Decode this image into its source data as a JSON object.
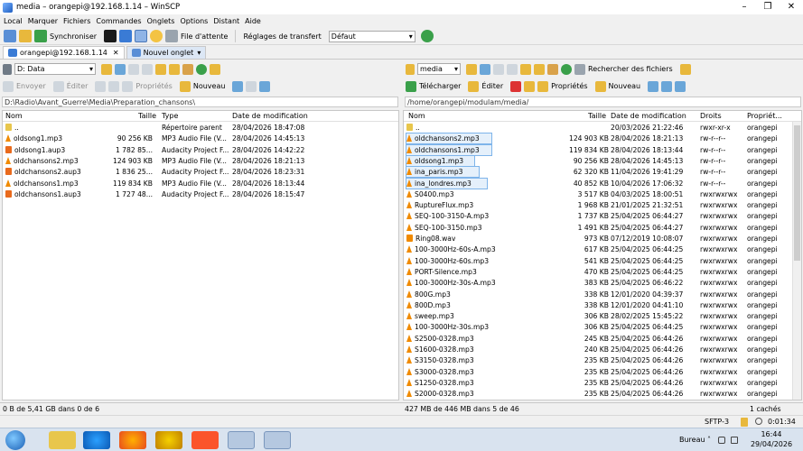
{
  "window": {
    "title": "media – orangepi@192.168.1.14 – WinSCP",
    "min": "–",
    "max": "❐",
    "close": "✕"
  },
  "menu": [
    "Local",
    "Marquer",
    "Fichiers",
    "Commandes",
    "Onglets",
    "Options",
    "Distant",
    "Aide"
  ],
  "toolbar": {
    "sync": "Synchroniser",
    "queue": "File d'attente",
    "transfer_settings": "Réglages de transfert",
    "transfer_value": "Défaut"
  },
  "tabs": {
    "session": "orangepi@192.168.1.14",
    "new": "Nouvel onglet"
  },
  "left": {
    "drive": "D: Data",
    "send": "Envoyer",
    "edit": "Éditer",
    "props": "Propriétés",
    "new": "Nouveau",
    "path": "D:\\Radio\\Avant_Guerre\\Media\\Preparation_chansons\\",
    "cols": [
      "Nom",
      "Taille",
      "Type",
      "Date de modification"
    ],
    "rows": [
      {
        "name": "..",
        "size": "",
        "type": "Répertoire parent",
        "date": "28/04/2026 18:47:08",
        "icon": "up"
      },
      {
        "name": "oldsong1.mp3",
        "size": "90 256 KB",
        "type": "MP3 Audio File (V...",
        "date": "28/04/2026 14:45:13",
        "icon": "mp3"
      },
      {
        "name": "oldsong1.aup3",
        "size": "1 782 85...",
        "type": "Audacity Project F...",
        "date": "28/04/2026 14:42:22",
        "icon": "aup"
      },
      {
        "name": "oldchansons2.mp3",
        "size": "124 903 KB",
        "type": "MP3 Audio File (V...",
        "date": "28/04/2026 18:21:13",
        "icon": "mp3"
      },
      {
        "name": "oldchansons2.aup3",
        "size": "1 836 25...",
        "type": "Audacity Project F...",
        "date": "28/04/2026 18:23:31",
        "icon": "aup"
      },
      {
        "name": "oldchansons1.mp3",
        "size": "119 834 KB",
        "type": "MP3 Audio File (V...",
        "date": "28/04/2026 18:13:44",
        "icon": "mp3"
      },
      {
        "name": "oldchansons1.aup3",
        "size": "1 727 48...",
        "type": "Audacity Project F...",
        "date": "28/04/2026 18:15:47",
        "icon": "aup"
      }
    ],
    "status": "0 B de 5,41 GB dans 0 de 6"
  },
  "right": {
    "folder": "media",
    "search": "Rechercher des fichiers",
    "download": "Télécharger",
    "edit": "Éditer",
    "props": "Propriétés",
    "new": "Nouveau",
    "path": "/home/orangepi/modulam/media/",
    "cols": [
      "Nom",
      "Taille",
      "Date de modification",
      "Droits",
      "Propriét..."
    ],
    "rows": [
      {
        "name": "..",
        "size": "",
        "date": "20/03/2026 21:22:46",
        "rights": "rwxr-xr-x",
        "owner": "orangepi",
        "icon": "up",
        "sel": false
      },
      {
        "name": "oldchansons2.mp3",
        "size": "124 903 KB",
        "date": "28/04/2026 18:21:13",
        "rights": "rw-r--r--",
        "owner": "orangepi",
        "icon": "mp3",
        "sel": true
      },
      {
        "name": "oldchansons1.mp3",
        "size": "119 834 KB",
        "date": "28/04/2026 18:13:44",
        "rights": "rw-r--r--",
        "owner": "orangepi",
        "icon": "mp3",
        "sel": true
      },
      {
        "name": "oldsong1.mp3",
        "size": "90 256 KB",
        "date": "28/04/2026 14:45:13",
        "rights": "rw-r--r--",
        "owner": "orangepi",
        "icon": "mp3",
        "sel": true
      },
      {
        "name": "ina_paris.mp3",
        "size": "62 320 KB",
        "date": "11/04/2026 19:41:29",
        "rights": "rw-r--r--",
        "owner": "orangepi",
        "icon": "mp3",
        "sel": true
      },
      {
        "name": "ina_londres.mp3",
        "size": "40 852 KB",
        "date": "10/04/2026 17:06:32",
        "rights": "rw-r--r--",
        "owner": "orangepi",
        "icon": "mp3",
        "sel": true
      },
      {
        "name": "S0400.mp3",
        "size": "3 517 KB",
        "date": "04/03/2025 18:00:51",
        "rights": "rwxrwxrwx",
        "owner": "orangepi",
        "icon": "mp3",
        "sel": false
      },
      {
        "name": "RuptureFlux.mp3",
        "size": "1 968 KB",
        "date": "21/01/2025 21:32:51",
        "rights": "rwxrwxrwx",
        "owner": "orangepi",
        "icon": "mp3",
        "sel": false
      },
      {
        "name": "SEQ-100-3150-A.mp3",
        "size": "1 737 KB",
        "date": "25/04/2025 06:44:27",
        "rights": "rwxrwxrwx",
        "owner": "orangepi",
        "icon": "mp3",
        "sel": false
      },
      {
        "name": "SEQ-100-3150.mp3",
        "size": "1 491 KB",
        "date": "25/04/2025 06:44:27",
        "rights": "rwxrwxrwx",
        "owner": "orangepi",
        "icon": "mp3",
        "sel": false
      },
      {
        "name": "Ring08.wav",
        "size": "973 KB",
        "date": "07/12/2019 10:08:07",
        "rights": "rwxrwxrwx",
        "owner": "orangepi",
        "icon": "wav",
        "sel": false
      },
      {
        "name": "100-3000Hz-60s-A.mp3",
        "size": "617 KB",
        "date": "25/04/2025 06:44:25",
        "rights": "rwxrwxrwx",
        "owner": "orangepi",
        "icon": "mp3",
        "sel": false
      },
      {
        "name": "100-3000Hz-60s.mp3",
        "size": "541 KB",
        "date": "25/04/2025 06:44:25",
        "rights": "rwxrwxrwx",
        "owner": "orangepi",
        "icon": "mp3",
        "sel": false
      },
      {
        "name": "PORT-Silence.mp3",
        "size": "470 KB",
        "date": "25/04/2025 06:44:25",
        "rights": "rwxrwxrwx",
        "owner": "orangepi",
        "icon": "mp3",
        "sel": false
      },
      {
        "name": "100-3000Hz-30s-A.mp3",
        "size": "383 KB",
        "date": "25/04/2025 06:46:22",
        "rights": "rwxrwxrwx",
        "owner": "orangepi",
        "icon": "mp3",
        "sel": false
      },
      {
        "name": "800G.mp3",
        "size": "338 KB",
        "date": "12/01/2020 04:39:37",
        "rights": "rwxrwxrwx",
        "owner": "orangepi",
        "icon": "mp3",
        "sel": false
      },
      {
        "name": "800D.mp3",
        "size": "338 KB",
        "date": "12/01/2020 04:41:10",
        "rights": "rwxrwxrwx",
        "owner": "orangepi",
        "icon": "mp3",
        "sel": false
      },
      {
        "name": "sweep.mp3",
        "size": "306 KB",
        "date": "28/02/2025 15:45:22",
        "rights": "rwxrwxrwx",
        "owner": "orangepi",
        "icon": "mp3",
        "sel": false
      },
      {
        "name": "100-3000Hz-30s.mp3",
        "size": "306 KB",
        "date": "25/04/2025 06:44:25",
        "rights": "rwxrwxrwx",
        "owner": "orangepi",
        "icon": "mp3",
        "sel": false
      },
      {
        "name": "S2500-0328.mp3",
        "size": "245 KB",
        "date": "25/04/2025 06:44:26",
        "rights": "rwxrwxrwx",
        "owner": "orangepi",
        "icon": "mp3",
        "sel": false
      },
      {
        "name": "S1600-0328.mp3",
        "size": "240 KB",
        "date": "25/04/2025 06:44:26",
        "rights": "rwxrwxrwx",
        "owner": "orangepi",
        "icon": "mp3",
        "sel": false
      },
      {
        "name": "S3150-0328.mp3",
        "size": "235 KB",
        "date": "25/04/2025 06:44:26",
        "rights": "rwxrwxrwx",
        "owner": "orangepi",
        "icon": "mp3",
        "sel": false
      },
      {
        "name": "S3000-0328.mp3",
        "size": "235 KB",
        "date": "25/04/2025 06:44:26",
        "rights": "rwxrwxrwx",
        "owner": "orangepi",
        "icon": "mp3",
        "sel": false
      },
      {
        "name": "S1250-0328.mp3",
        "size": "235 KB",
        "date": "25/04/2025 06:44:26",
        "rights": "rwxrwxrwx",
        "owner": "orangepi",
        "icon": "mp3",
        "sel": false
      },
      {
        "name": "S2000-0328.mp3",
        "size": "235 KB",
        "date": "25/04/2025 06:44:26",
        "rights": "rwxrwxrwx",
        "owner": "orangepi",
        "icon": "mp3",
        "sel": false
      }
    ],
    "status": "427 MB de 446 MB dans 5 de 46",
    "hidden": "1 cachés"
  },
  "statusbar": {
    "protocol": "SFTP-3",
    "time": "0:01:34"
  },
  "taskbar": {
    "label": "Bureau",
    "clock_time": "16:44",
    "clock_date": "29/04/2026"
  }
}
